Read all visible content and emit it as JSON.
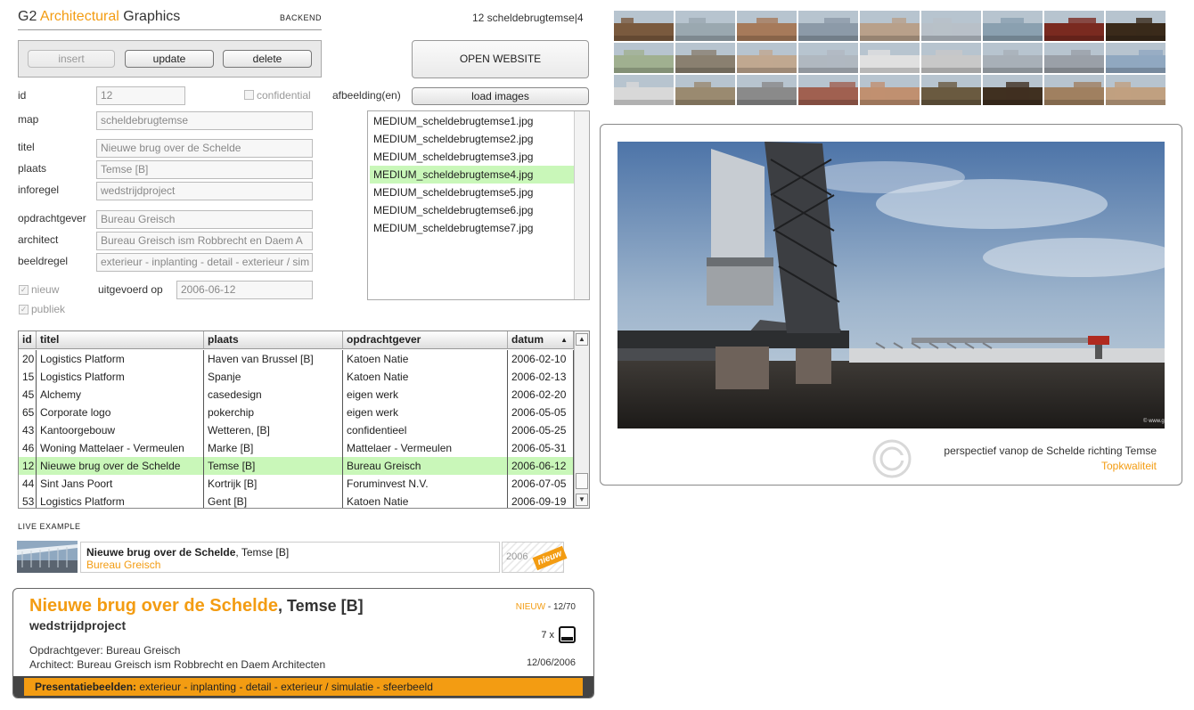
{
  "header": {
    "brand_g2": "G2",
    "brand_arch": "Architectural",
    "brand_graphics": "Graphics",
    "backend": "BACKEND",
    "record_info": "12 scheldebrugtemse|4"
  },
  "toolbar": {
    "insert": "insert",
    "update": "update",
    "delete": "delete",
    "open_website": "OPEN WEBSITE",
    "load_images": "load images"
  },
  "form": {
    "id_label": "id",
    "id_value": "12",
    "confidential_label": "confidential",
    "map_label": "map",
    "map_value": "scheldebrugtemse",
    "afbeelding_label": "afbeelding(en)",
    "titel_label": "titel",
    "titel_value": "Nieuwe brug over de Schelde",
    "plaats_label": "plaats",
    "plaats_value": "Temse [B]",
    "inforegel_label": "inforegel",
    "inforegel_value": "wedstrijdproject",
    "opdrachtgever_label": "opdrachtgever",
    "opdrachtgever_value": "Bureau Greisch",
    "architect_label": "architect",
    "architect_value": "Bureau Greisch ism Robbrecht en Daem A",
    "beeldregel_label": "beeldregel",
    "beeldregel_value": "exterieur - inplanting - detail - exterieur / sim",
    "nieuw_label": "nieuw",
    "uitgevoerd_label": "uitgevoerd op",
    "uitgevoerd_value": "2006-06-12",
    "publiek_label": "publiek"
  },
  "images": [
    "MEDIUM_scheldebrugtemse1.jpg",
    "MEDIUM_scheldebrugtemse2.jpg",
    "MEDIUM_scheldebrugtemse3.jpg",
    "MEDIUM_scheldebrugtemse4.jpg",
    "MEDIUM_scheldebrugtemse5.jpg",
    "MEDIUM_scheldebrugtemse6.jpg",
    "MEDIUM_scheldebrugtemse7.jpg"
  ],
  "grid": {
    "columns": [
      "id",
      "titel",
      "plaats",
      "opdrachtgever",
      "datum"
    ],
    "sort_indicator": "▲",
    "rows": [
      [
        "20",
        "Logistics Platform",
        "Haven van Brussel [B]",
        "Katoen Natie",
        "2006-02-10"
      ],
      [
        "15",
        "Logistics Platform",
        "Spanje",
        "Katoen Natie",
        "2006-02-13"
      ],
      [
        "45",
        "Alchemy",
        "casedesign",
        "eigen werk",
        "2006-02-20"
      ],
      [
        "65",
        "Corporate logo",
        "pokerchip",
        "eigen werk",
        "2006-05-05"
      ],
      [
        "43",
        "Kantoorgebouw",
        "Wetteren, [B]",
        "confidentieel",
        "2006-05-25"
      ],
      [
        "46",
        "Woning Mattelaer - Vermeulen",
        "Marke [B]",
        "Mattelaer - Vermeulen",
        "2006-05-31"
      ],
      [
        "12",
        "Nieuwe brug over de Schelde",
        "Temse [B]",
        "Bureau Greisch",
        "2006-06-12"
      ],
      [
        "44",
        "Sint Jans Poort",
        "Kortrijk [B]",
        "Foruminvest N.V.",
        "2006-07-05"
      ],
      [
        "53",
        "Logistics Platform",
        "Gent [B]",
        "Katoen Natie",
        "2006-09-19"
      ]
    ]
  },
  "live": {
    "label": "LIVE EXAMPLE",
    "title": "Nieuwe brug over de Schelde",
    "place": ", Temse [B]",
    "client": "Bureau Greisch",
    "year": "2006",
    "tag": "nieuw"
  },
  "card": {
    "title": "Nieuwe brug over de Schelde",
    "place": ", Temse [B]",
    "subtitle": "wedstrijdproject",
    "nieuw": "NIEUW",
    "index": " - 12/70",
    "count": "7 x",
    "opdrachtgever": "Opdrachtgever: Bureau Greisch",
    "architect": "Architect: Bureau Greisch ism Robbrecht en Daem Architecten",
    "date": "12/06/2006",
    "band_label": "Presentatiebeelden:",
    "band_value": " exterieur - inplanting - detail - exterieur / simulatie - sfeerbeeld"
  },
  "preview": {
    "caption": "perspectief vanop de Schelde richting Temse",
    "quality": "Topkwaliteit"
  },
  "thumbnail_palette": [
    "#7a5a3e",
    "#9aa8b0",
    "#a67a5a",
    "#8c9aa8",
    "#b8a08a",
    "#b8c0c8",
    "#8aa0b0",
    "#7a2a20",
    "#3a2a1a",
    "#a0b090",
    "#8a8070",
    "#c0a890",
    "#b0b8c0",
    "#e0e0e0",
    "#c8c8c8",
    "#a8b0b8",
    "#9aa0a8",
    "#90a8c0",
    "#d8d8d8",
    "#9a8a70",
    "#8a8a8a",
    "#a06050",
    "#c09070",
    "#6a5a40",
    "#403020",
    "#a08060",
    "#c0a080"
  ]
}
